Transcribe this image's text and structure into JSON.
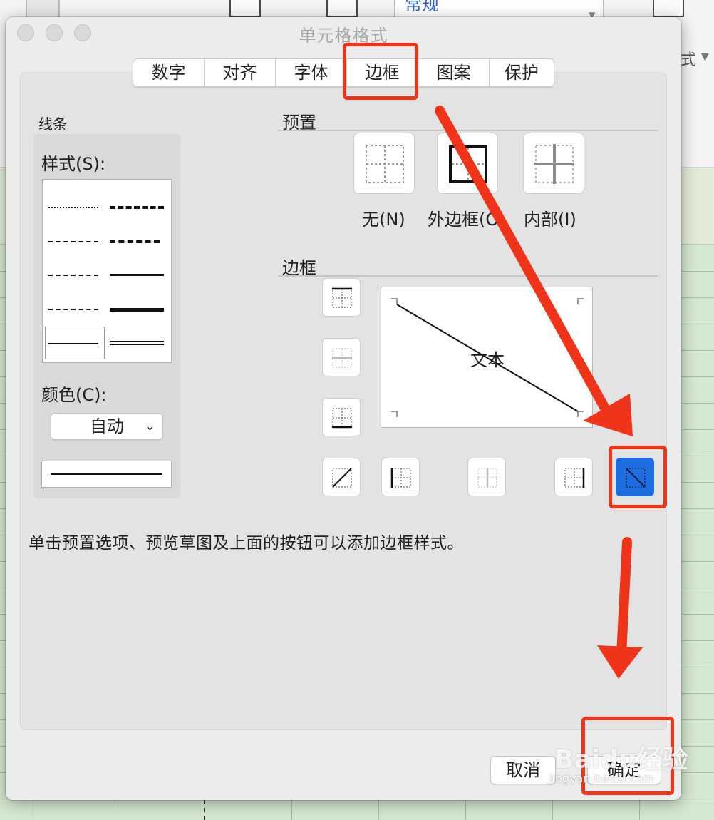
{
  "background": {
    "format_select_value": "常规",
    "style_label": "式"
  },
  "dialog": {
    "title": "单元格格式",
    "tabs": [
      {
        "label": "数字"
      },
      {
        "label": "对齐"
      },
      {
        "label": "字体"
      },
      {
        "label": "边框"
      },
      {
        "label": "图案"
      },
      {
        "label": "保护"
      }
    ],
    "active_tab": "边框",
    "line_section": {
      "title": "线条",
      "style_label": "样式(S):",
      "color_label": "颜色(C):",
      "color_value": "自动"
    },
    "preset_section": {
      "title": "预置",
      "presets": [
        {
          "label": "无(N)",
          "icon": "preset-none-icon"
        },
        {
          "label": "外边框(O)",
          "icon": "preset-outline-icon"
        },
        {
          "label": "内部(I)",
          "icon": "preset-inside-icon"
        }
      ]
    },
    "border_section": {
      "title": "边框",
      "preview_text": "文本",
      "active_button": "diagonal-down-border"
    },
    "hint": "单击预置选项、预览草图及上面的按钮可以添加边框样式。",
    "buttons": {
      "cancel": "取消",
      "ok": "确定"
    }
  },
  "watermark": {
    "brand": "Baidu经验",
    "url": "jingyan.baidu.com"
  },
  "colors": {
    "annotation_red": "#f0341a",
    "active_blue": "#1f6ee0"
  }
}
